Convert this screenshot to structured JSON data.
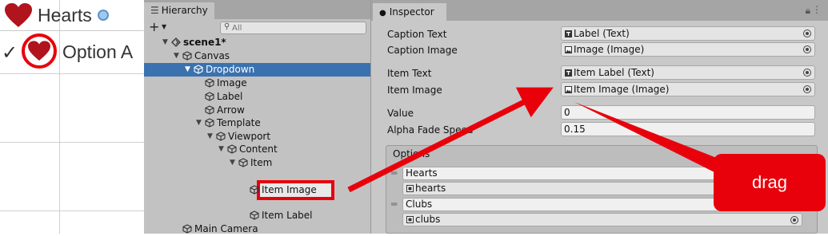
{
  "preview": {
    "caption_text": "Hearts",
    "option_text": "Option A",
    "check_glyph": "✓",
    "heart_color": "#b0141c",
    "highlight_color": "#e8000b"
  },
  "hierarchy": {
    "tab_label": "Hierarchy",
    "tab_icon": "list-icon",
    "add_button": "+",
    "search_placeholder": "All",
    "rows": [
      {
        "label": "scene1*",
        "depth": 0,
        "expanded": true,
        "icon": "unity-scene-icon",
        "bold": true
      },
      {
        "label": "Canvas",
        "depth": 1,
        "expanded": true,
        "icon": "gameobject-cube-icon"
      },
      {
        "label": "Dropdown",
        "depth": 2,
        "expanded": true,
        "icon": "gameobject-cube-icon",
        "selected": true
      },
      {
        "label": "Image",
        "depth": 3,
        "icon": "gameobject-cube-icon"
      },
      {
        "label": "Label",
        "depth": 3,
        "icon": "gameobject-cube-icon"
      },
      {
        "label": "Arrow",
        "depth": 3,
        "icon": "gameobject-cube-icon"
      },
      {
        "label": "Template",
        "depth": 3,
        "expanded": true,
        "icon": "gameobject-cube-icon"
      },
      {
        "label": "Viewport",
        "depth": 4,
        "expanded": true,
        "icon": "gameobject-cube-icon"
      },
      {
        "label": "Content",
        "depth": 5,
        "expanded": true,
        "icon": "gameobject-cube-icon"
      },
      {
        "label": "Item",
        "depth": 6,
        "expanded": true,
        "icon": "gameobject-cube-icon"
      },
      {
        "label": "Item Image",
        "depth": 7,
        "icon": "gameobject-cube-icon",
        "highlighted": true
      },
      {
        "label": "Item Label",
        "depth": 7,
        "icon": "gameobject-cube-icon"
      },
      {
        "label": "Main Camera",
        "depth": 1,
        "icon": "gameobject-cube-icon"
      }
    ]
  },
  "inspector": {
    "tab_label": "Inspector",
    "tab_icon": "info-icon",
    "properties": [
      {
        "label": "Caption Text",
        "value": "Label (Text)",
        "kind": "object",
        "icon": "text-component-icon"
      },
      {
        "label": "Caption Image",
        "value": "Image (Image)",
        "kind": "object",
        "icon": "image-component-icon"
      },
      {
        "label": "Item Text",
        "value": "Item Label (Text)",
        "kind": "object",
        "icon": "text-component-icon"
      },
      {
        "label": "Item Image",
        "value": "Item Image (Image)",
        "kind": "object",
        "icon": "image-component-icon"
      },
      {
        "label": "Value",
        "value": "0",
        "kind": "number"
      },
      {
        "label": "Alpha Fade Speed",
        "value": "0.15",
        "kind": "number"
      }
    ],
    "options_title": "Options",
    "options": [
      {
        "text": "Hearts",
        "image": "hearts"
      },
      {
        "text": "Clubs",
        "image": "clubs"
      }
    ]
  },
  "annotation": {
    "callout_text": "drag",
    "arrow_color": "#e8000b"
  }
}
